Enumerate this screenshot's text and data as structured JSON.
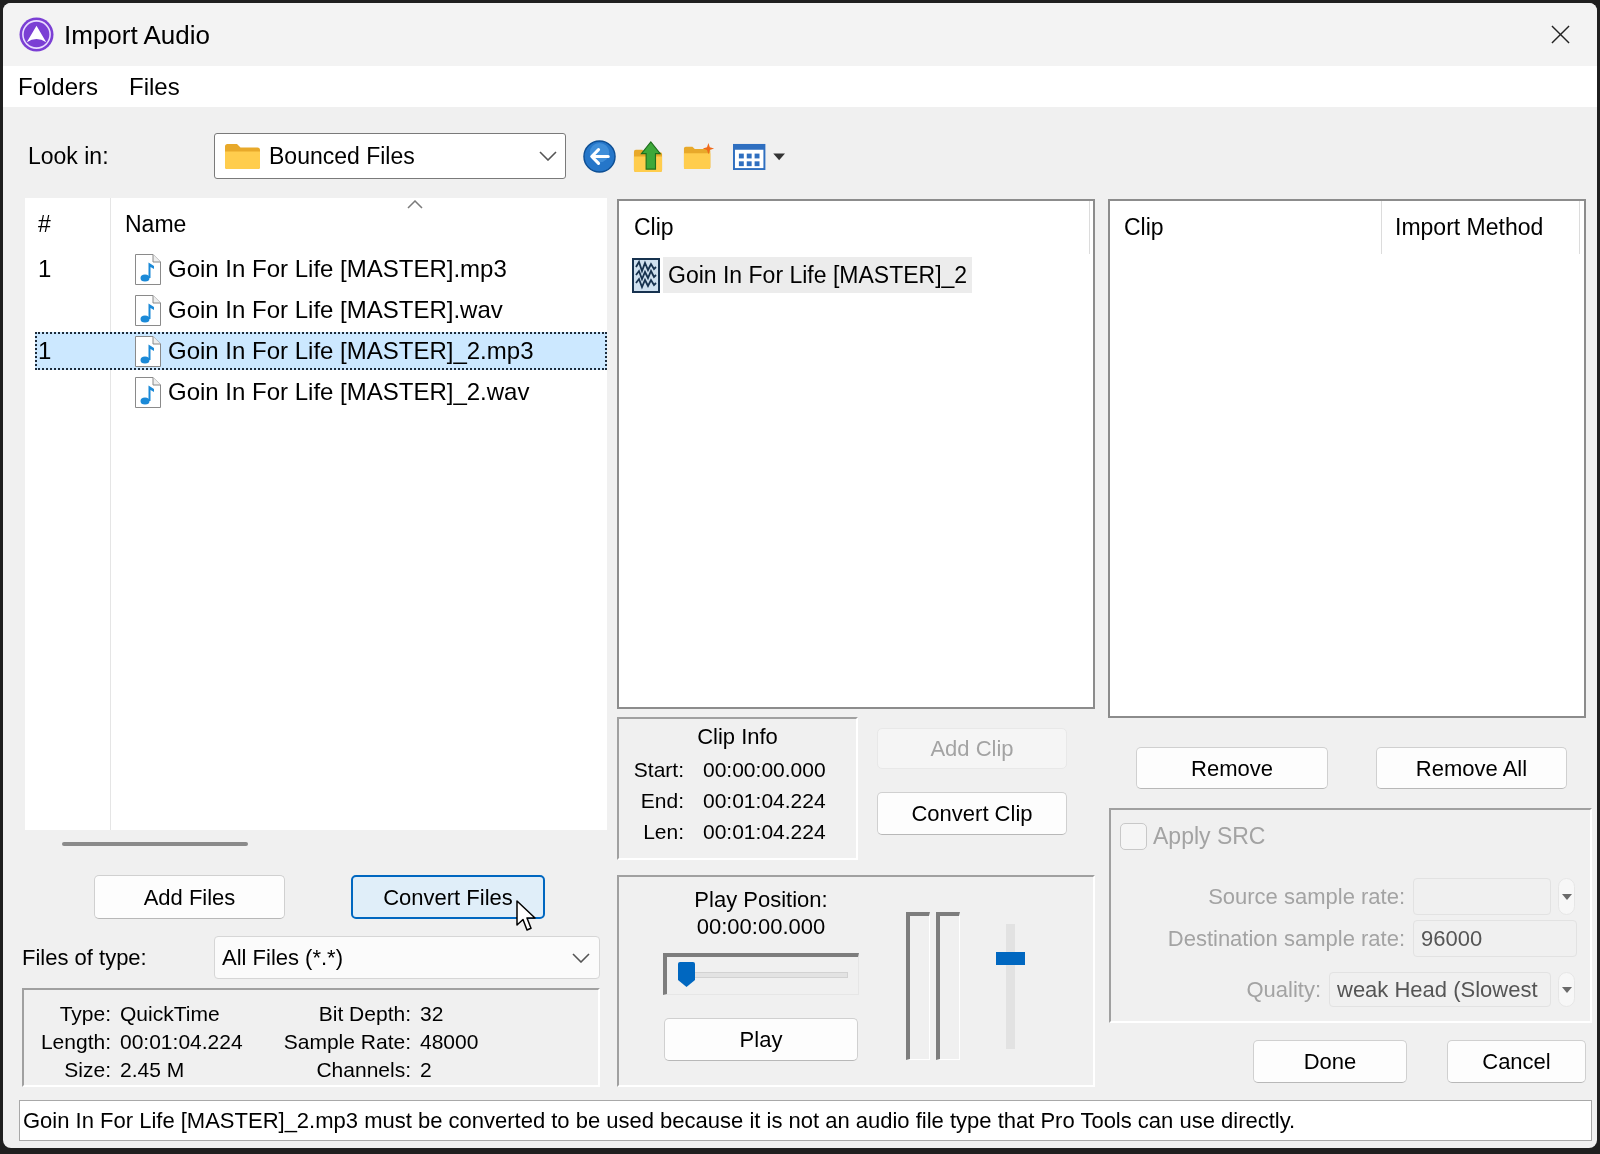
{
  "window": {
    "title": "Import Audio"
  },
  "menu": [
    {
      "label": "Folders"
    },
    {
      "label": "Files"
    }
  ],
  "look_in": {
    "label": "Look in:",
    "value": "Bounced Files"
  },
  "file_list": {
    "columns": [
      {
        "label": "#",
        "sorted": false
      },
      {
        "label": "Name",
        "sorted": true
      }
    ],
    "rows": [
      {
        "number": "1",
        "name": "Goin In For Life [MASTER].mp3",
        "selected": false
      },
      {
        "name": "Goin In For Life [MASTER].wav",
        "selected": false
      },
      {
        "number": "1",
        "name": "Goin In For Life [MASTER]_2.mp3",
        "selected": true
      },
      {
        "name": "Goin In For Life [MASTER]_2.wav",
        "selected": false
      }
    ]
  },
  "file_buttons": [
    {
      "label": "Add Files",
      "focused": false
    },
    {
      "label": "Convert Files",
      "focused": true
    }
  ],
  "files_of_type": {
    "label": "Files of type:",
    "value": "All Files (*.*)"
  },
  "file_info": [
    {
      "label": "Type:",
      "value": "QuickTime"
    },
    {
      "label": "Bit Depth:",
      "value": "32"
    },
    {
      "label": "Length:",
      "value": "00:01:04.224"
    },
    {
      "label": "Sample Rate:",
      "value": "48000"
    },
    {
      "label": "Size:",
      "value": "2.45 M"
    },
    {
      "label": "Channels:",
      "value": "2"
    }
  ],
  "clip_list": {
    "columns": [
      "Clip"
    ],
    "items": [
      {
        "name": "Goin In For Life [MASTER]_2",
        "selected": true
      }
    ]
  },
  "clip_info": {
    "title": "Clip Info",
    "fields": [
      {
        "label": "Start:",
        "value": "00:00:00.000"
      },
      {
        "label": "End:",
        "value": "00:01:04.224"
      },
      {
        "label": "Len:",
        "value": "00:01:04.224"
      }
    ]
  },
  "clip_buttons": [
    {
      "label": "Add Clip",
      "disabled": true
    },
    {
      "label": "Convert Clip",
      "disabled": false
    }
  ],
  "playback": {
    "label": "Play Position:",
    "time": "00:00:00.000",
    "position": {
      "level": 0
    },
    "play_button": "Play",
    "volume": {
      "level": 0.75
    }
  },
  "import_list": {
    "columns": [
      "Clip",
      "Import Method"
    ]
  },
  "list_buttons": [
    {
      "label": "Remove"
    },
    {
      "label": "Remove All"
    }
  ],
  "src": {
    "disabled": true,
    "apply": {
      "label": "Apply SRC",
      "checked": false
    },
    "fields": [
      {
        "kind": "dropdown",
        "label": "Source sample rate:"
      },
      {
        "kind": "text",
        "label": "Destination sample rate:",
        "value": "96000"
      },
      {
        "kind": "dropdown",
        "label": "Quality:",
        "value": "weak Head (Slowest"
      }
    ]
  },
  "dialog_buttons": [
    {
      "label": "Done"
    },
    {
      "label": "Cancel"
    }
  ],
  "status": "Goin In For Life [MASTER]_2.mp3 must be converted to be used because it is not an audio file type that Pro Tools can use directly."
}
